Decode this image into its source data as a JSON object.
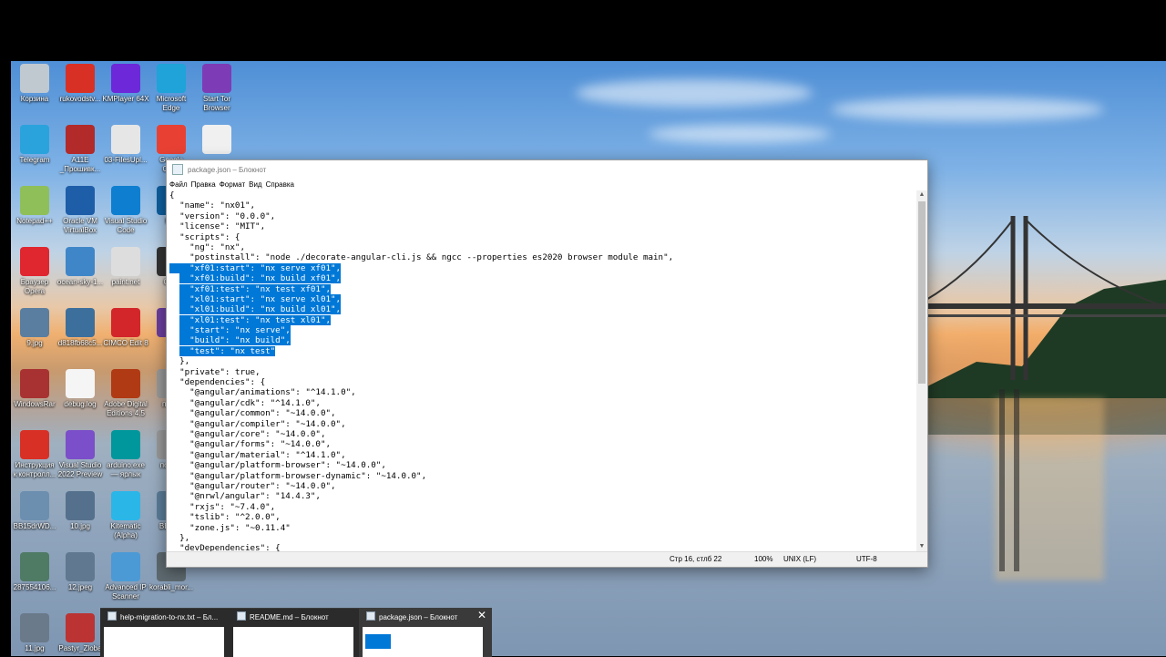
{
  "desktop": {
    "icons": [
      {
        "label": "Корзина",
        "color": "#c0c8d0"
      },
      {
        "label": "rukovodstv...",
        "color": "#d93025"
      },
      {
        "label": "KMPlayer 64X",
        "color": "#6d28d9"
      },
      {
        "label": "Microsoft\nEdge",
        "color": "#1fa3d8"
      },
      {
        "label": "Start Tor\nBrowser",
        "color": "#7d3cb5"
      },
      {
        "label": "Telegram",
        "color": "#2aa3dc"
      },
      {
        "label": "A11E\n_Прошивк...",
        "color": "#b22a2a"
      },
      {
        "label": "03-FilesUpl...",
        "color": "#e6e6e6"
      },
      {
        "label": "Google\nChr...",
        "color": "#e84134"
      },
      {
        "label": "",
        "color": "#f0f0f0"
      },
      {
        "label": "Notepad++",
        "color": "#8fbf58"
      },
      {
        "label": "Oracle VM\nVirtualBox",
        "color": "#1e5da8"
      },
      {
        "label": "Visual Studio\nCode",
        "color": "#0e7fd0"
      },
      {
        "label": "M...",
        "color": "#0e5fa0"
      },
      {
        "label": "Браузер\nOpera",
        "color": "#e0262f"
      },
      {
        "label": "ocean-sky-1...",
        "color": "#3f86c8"
      },
      {
        "label": "paint.net",
        "color": "#ddd"
      },
      {
        "label": "OBS",
        "color": "#333"
      },
      {
        "label": "9.jpg",
        "color": "#5a7ea0"
      },
      {
        "label": "d818fb68c5...",
        "color": "#3d6f9c"
      },
      {
        "label": "CIMCO Edit 8",
        "color": "#d2262a"
      },
      {
        "label": "Tor",
        "color": "#6b3fa0"
      },
      {
        "label": "WindowsRar",
        "color": "#a83232"
      },
      {
        "label": "debug.log",
        "color": "#f5f5f5"
      },
      {
        "label": "Adobe Digital\nEditions 4.5",
        "color": "#b03a14"
      },
      {
        "label": "пол...",
        "color": "#999"
      },
      {
        "label": "Инструкция\nк контролл...",
        "color": "#d93025"
      },
      {
        "label": "Visual Studio\n2022 Preview",
        "color": "#7b4fc9"
      },
      {
        "label": "arduino.exe\n— ярлык",
        "color": "#00979c"
      },
      {
        "label": "поли...",
        "color": "#999"
      },
      {
        "label": "BB15drWD...",
        "color": "#6c8fb0"
      },
      {
        "label": "10.jpg",
        "color": "#54708c"
      },
      {
        "label": "Kitematic\n(Alpha)",
        "color": "#2bb6e8"
      },
      {
        "label": "BB18...",
        "color": "#5b7d99"
      },
      {
        "label": "287554106...",
        "color": "#4f7a64"
      },
      {
        "label": "12.jpeg",
        "color": "#607890"
      },
      {
        "label": "Advanced IP\nScanner",
        "color": "#4b9ad6"
      },
      {
        "label": "korabli_mor...",
        "color": "#5e6a70"
      },
      {
        "label": "11.jpg",
        "color": "#6a7a8a"
      },
      {
        "label": "Pastyr_Zloba",
        "color": "#b33"
      }
    ]
  },
  "notepad": {
    "title": "package.json – Блокнот",
    "menu": [
      "Файл",
      "Правка",
      "Формат",
      "Вид",
      "Справка"
    ],
    "lines": [
      {
        "text": "{",
        "sel": false
      },
      {
        "text": "  \"name\": \"nx01\",",
        "sel": false
      },
      {
        "text": "  \"version\": \"0.0.0\",",
        "sel": false
      },
      {
        "text": "  \"license\": \"MIT\",",
        "sel": false
      },
      {
        "text": "  \"scripts\": {",
        "sel": false
      },
      {
        "text": "    \"ng\": \"nx\",",
        "sel": false
      },
      {
        "text": "    \"postinstall\": \"node ./decorate-angular-cli.js && ngcc --properties es2020 browser module main\",",
        "sel": false
      },
      {
        "text": "    \"xf01:start\": \"nx serve xf01\",",
        "sel": true
      },
      {
        "text": "    \"xf01:build\": \"nx build xf01\",",
        "sel": true
      },
      {
        "text": "    \"xf01:test\": \"nx test xf01\",",
        "sel": true
      },
      {
        "text": "    \"xl01:start\": \"nx serve xl01\",",
        "sel": true
      },
      {
        "text": "    \"xl01:build\": \"nx build xl01\",",
        "sel": true
      },
      {
        "text": "    \"xl01:test\": \"nx test xl01\",",
        "sel": true
      },
      {
        "text": "    \"start\": \"nx serve\",",
        "sel": true
      },
      {
        "text": "    \"build\": \"nx build\",",
        "sel": true
      },
      {
        "text": "    \"test\": \"nx test\"",
        "sel": true
      },
      {
        "text": "  },",
        "sel": false
      },
      {
        "text": "  \"private\": true,",
        "sel": false
      },
      {
        "text": "  \"dependencies\": {",
        "sel": false
      },
      {
        "text": "    \"@angular/animations\": \"^14.1.0\",",
        "sel": false
      },
      {
        "text": "    \"@angular/cdk\": \"^14.1.0\",",
        "sel": false
      },
      {
        "text": "    \"@angular/common\": \"~14.0.0\",",
        "sel": false
      },
      {
        "text": "    \"@angular/compiler\": \"~14.0.0\",",
        "sel": false
      },
      {
        "text": "    \"@angular/core\": \"~14.0.0\",",
        "sel": false
      },
      {
        "text": "    \"@angular/forms\": \"~14.0.0\",",
        "sel": false
      },
      {
        "text": "    \"@angular/material\": \"^14.1.0\",",
        "sel": false
      },
      {
        "text": "    \"@angular/platform-browser\": \"~14.0.0\",",
        "sel": false
      },
      {
        "text": "    \"@angular/platform-browser-dynamic\": \"~14.0.0\",",
        "sel": false
      },
      {
        "text": "    \"@angular/router\": \"~14.0.0\",",
        "sel": false
      },
      {
        "text": "    \"@nrwl/angular\": \"14.4.3\",",
        "sel": false
      },
      {
        "text": "    \"rxjs\": \"~7.4.0\",",
        "sel": false
      },
      {
        "text": "    \"tslib\": \"^2.0.0\",",
        "sel": false
      },
      {
        "text": "    \"zone.js\": \"~0.11.4\"",
        "sel": false
      },
      {
        "text": "  },",
        "sel": false
      },
      {
        "text": "  \"devDependencies\": {",
        "sel": false
      }
    ],
    "status": {
      "position": "Стр 16, стлб 22",
      "zoom": "100%",
      "line_ending": "UNIX (LF)",
      "encoding": "UTF-8"
    }
  },
  "taskbar_previews": [
    {
      "title": "help-migration-to-nx.txt – Бл...",
      "active": false
    },
    {
      "title": "README.md – Блокнот",
      "active": false
    },
    {
      "title": "package.json – Блокнот",
      "active": true
    }
  ],
  "colors": {
    "selection": "#0078d7",
    "preview_active": "#3a3a3a"
  }
}
